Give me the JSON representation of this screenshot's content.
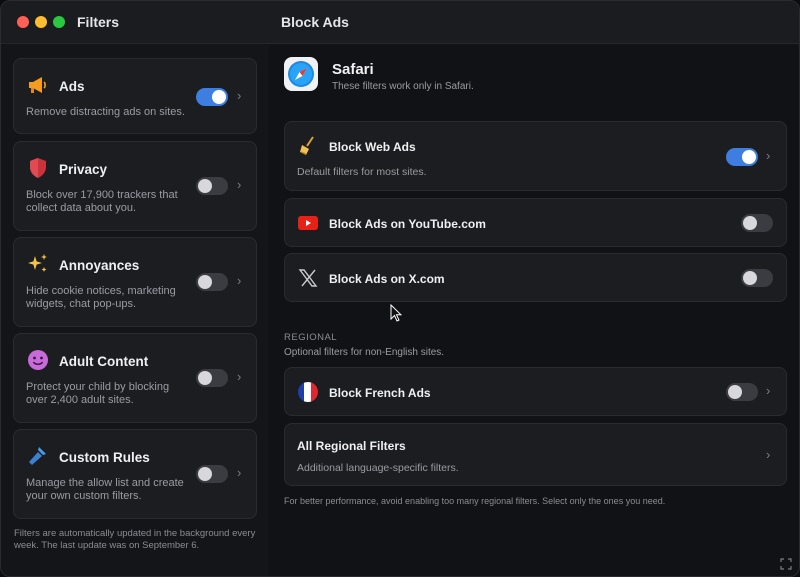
{
  "window": {
    "sidebar_title": "Filters",
    "main_title": "Block Ads"
  },
  "sidebar": {
    "items": [
      {
        "title": "Ads",
        "description": "Remove distracting ads on sites.",
        "icon": "megaphone-icon",
        "enabled": true
      },
      {
        "title": "Privacy",
        "description": "Block over 17,900 trackers that collect data about you.",
        "icon": "shield-icon",
        "enabled": false
      },
      {
        "title": "Annoyances",
        "description": "Hide cookie notices, marketing widgets, chat pop-ups.",
        "icon": "sparkles-icon",
        "enabled": false
      },
      {
        "title": "Adult Content",
        "description": "Protect your child by blocking over 2,400 adult sites.",
        "icon": "smiley-icon",
        "enabled": false
      },
      {
        "title": "Custom Rules",
        "description": "Manage the allow list and create your own custom filters.",
        "icon": "hammer-icon",
        "enabled": false
      }
    ],
    "footer": "Filters are automatically updated in the background every week. The last update was on September 6."
  },
  "main": {
    "browser": {
      "name": "Safari",
      "subtitle": "These filters work only in Safari.",
      "icon": "safari-compass-icon"
    },
    "filters": [
      {
        "title": "Block Web Ads",
        "description": "Default filters for most sites.",
        "icon": "broom-icon",
        "enabled": true
      },
      {
        "title": "Block Ads on YouTube.com",
        "icon": "youtube-icon",
        "enabled": false
      },
      {
        "title": "Block Ads on X.com",
        "icon": "x-logo-icon",
        "enabled": false
      }
    ],
    "regional": {
      "heading": "REGIONAL",
      "subtitle": "Optional filters for non-English sites.",
      "french": {
        "title": "Block French Ads",
        "icon": "french-flag-icon",
        "enabled": false
      },
      "all": {
        "title": "All Regional Filters",
        "description": "Additional language-specific filters."
      }
    },
    "footer": "For better performance, avoid enabling too many regional filters. Select only the ones you need."
  },
  "colors": {
    "accent": "#3d7ee0",
    "background": "#131417",
    "card": "#1c1d21"
  }
}
